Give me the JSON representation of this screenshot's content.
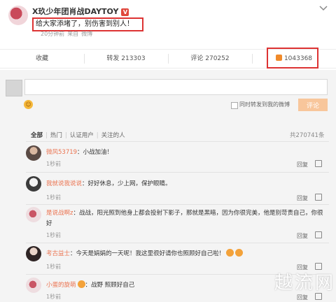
{
  "post": {
    "author": "X玖少年团肖战DAYTOY",
    "verified_badge": "V",
    "content": "给大家添堵了，别伤害到别人！",
    "time": "20分钟前",
    "source_prefix": "来自",
    "source": "微博"
  },
  "actions": {
    "favorite": "收藏",
    "repost": "转发 213303",
    "comment": "评论 270252",
    "like_count": "1043368"
  },
  "composer": {
    "placeholder": "",
    "emoji_icon": "smiley-icon",
    "sync_label": "同时转发到我的微博",
    "submit_label": "评论"
  },
  "filters": {
    "items": [
      "全部",
      "热门",
      "认证用户",
      "关注的人"
    ],
    "total": "共270741条"
  },
  "comments": [
    {
      "user": "微风53719",
      "text": "：小战加油！",
      "time": "1秒前",
      "reply": "回复"
    },
    {
      "user": "我就说我说说",
      "text": "：好好休息，少上网，保护眼睛。",
      "time": "1秒前",
      "reply": "回复"
    },
    {
      "user": "是说战啊z",
      "text": "：战战，阳光照到他身上都会投射下影子，那就是黑暗，因为你很完美，他是别苛责自己，你很",
      "text2": "好",
      "time": "1秒前",
      "reply": "回复"
    },
    {
      "user": "考古益士",
      "text": "：今天是娟娟的一天呢！我这里很好请你也照顾好自己啦！",
      "time": "1秒前",
      "reply": "回复"
    },
    {
      "user": "小蛋的旋萌",
      "text": "：战野 照顾好自己",
      "time": "1秒前",
      "reply": "回复"
    }
  ],
  "watermark": "越流网",
  "colors": {
    "accent": "#eb7350",
    "highlight_border": "#dd3333",
    "submit_disabled": "#f8c69b"
  }
}
